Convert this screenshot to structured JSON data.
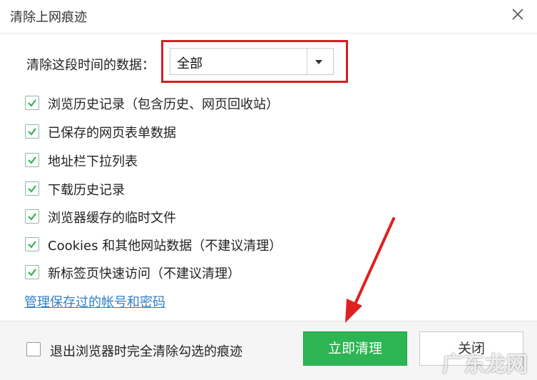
{
  "window": {
    "title": "清除上网痕迹",
    "close_icon": "close-icon"
  },
  "period": {
    "label": "清除这段时间的数据：",
    "selected": "全部"
  },
  "options": [
    {
      "label": "浏览历史记录（包含历史、网页回收站）",
      "checked": true
    },
    {
      "label": "已保存的网页表单数据",
      "checked": true
    },
    {
      "label": "地址栏下拉列表",
      "checked": true
    },
    {
      "label": "下载历史记录",
      "checked": true
    },
    {
      "label": "浏览器缓存的临时文件",
      "checked": true
    },
    {
      "label": "Cookies 和其他网站数据（不建议清理）",
      "checked": true
    },
    {
      "label": "新标签页快速访问（不建议清理）",
      "checked": true
    }
  ],
  "manage_link": "管理保存过的帐号和密码",
  "footer": {
    "exit_option": {
      "label": "退出浏览器时完全清除勾选的痕迹",
      "checked": false
    },
    "clear_button": "立即清理",
    "close_button": "关闭"
  },
  "colors": {
    "accent_green": "#2db553",
    "annotation_red": "#d61f23",
    "link_blue": "#2f7fc8"
  },
  "watermark": "广东龙网"
}
